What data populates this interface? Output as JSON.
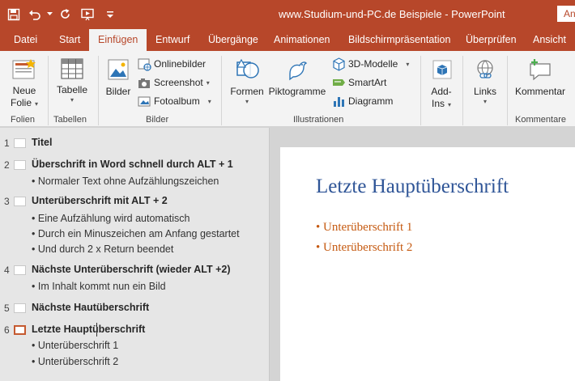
{
  "window": {
    "title": "www.Studium-und-PC.de  Beispiele  -  PowerPoint",
    "account_label": "An"
  },
  "tabs": [
    {
      "label": "Datei"
    },
    {
      "label": "Start"
    },
    {
      "label": "Einfügen"
    },
    {
      "label": "Entwurf"
    },
    {
      "label": "Übergänge"
    },
    {
      "label": "Animationen"
    },
    {
      "label": "Bildschirmpräsentation"
    },
    {
      "label": "Überprüfen"
    },
    {
      "label": "Ansicht"
    }
  ],
  "ribbon": {
    "folien": {
      "new_slide_line1": "Neue",
      "new_slide_line2": "Folie",
      "label": "Folien"
    },
    "tabellen": {
      "table": "Tabelle",
      "label": "Tabellen"
    },
    "bilder": {
      "pictures": "Bilder",
      "online": "Onlinebilder",
      "screenshot": "Screenshot",
      "album": "Fotoalbum",
      "label": "Bilder"
    },
    "illustrationen": {
      "shapes": "Formen",
      "icons": "Piktogramme",
      "models3d": "3D-Modelle",
      "smartart": "SmartArt",
      "chart": "Diagramm",
      "label": "Illustrationen"
    },
    "addins": {
      "line1": "Add-",
      "line2": "Ins"
    },
    "links": {
      "links": "Links"
    },
    "kommentare": {
      "comment": "Kommentar",
      "label": "Kommentare"
    }
  },
  "outline": {
    "slides": [
      {
        "num": "1",
        "title": "Titel",
        "bullets": []
      },
      {
        "num": "2",
        "title": "Überschrift in Word schnell durch ALT + 1",
        "bullets": [
          "Normaler Text ohne Aufzählungszeichen"
        ]
      },
      {
        "num": "3",
        "title": "Unterüberschrift mit ALT + 2",
        "bullets": [
          "Eine Aufzählung wird automatisch",
          "Durch ein Minuszeichen am Anfang gestartet",
          "Und durch 2 x Return beendet"
        ]
      },
      {
        "num": "4",
        "title": "Nächste Unterüberschrift (wieder ALT +2)",
        "bullets": [
          "Im Inhalt kommt nun ein Bild"
        ]
      },
      {
        "num": "5",
        "title": "Nächste Hautüberschrift",
        "bullets": []
      },
      {
        "num": "6",
        "title": "Letzte Hauptüberschrift",
        "bullets": [
          "Unterüberschrift 1",
          "Unterüberschrift 2"
        ]
      }
    ]
  },
  "slide": {
    "title": "Letzte Hauptüberschrift",
    "bullets": [
      "Unterüberschrift 1",
      "Unterüberschrift 2"
    ]
  },
  "colors": {
    "accent": "#b7472a",
    "slide_title": "#2f5597",
    "slide_bullet": "#c55a11"
  }
}
